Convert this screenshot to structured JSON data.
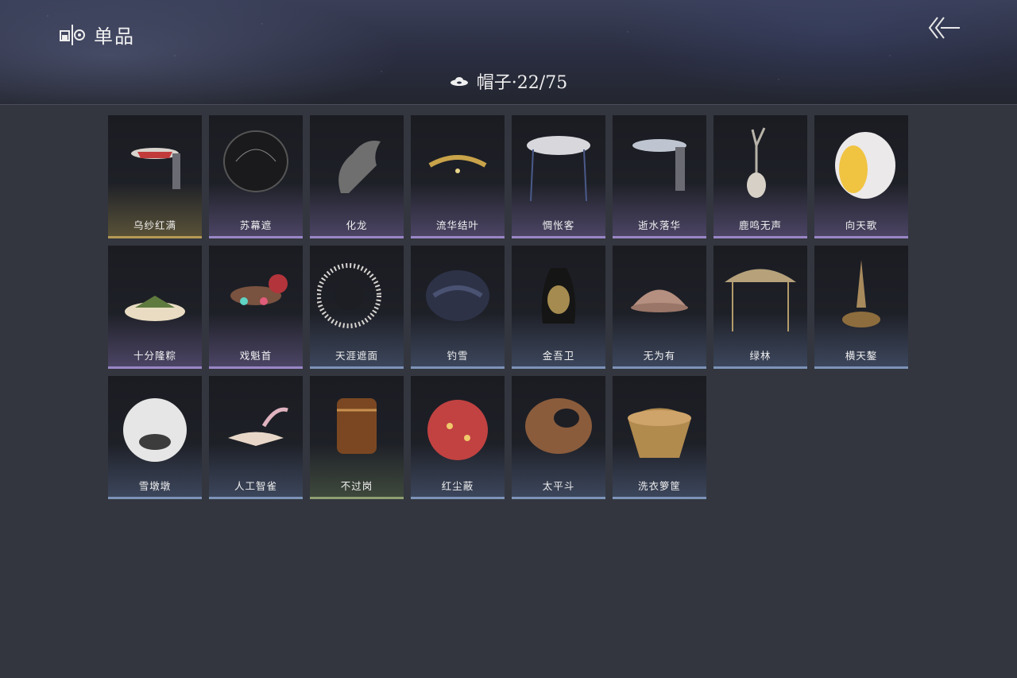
{
  "header": {
    "title": "单品",
    "category_label": "帽子·22/75",
    "icons": {
      "title": "wardrobe-icon",
      "category": "hat-icon",
      "back": "back-arrow-icon"
    }
  },
  "items": [
    {
      "name": "乌纱红满",
      "rarity": "gold"
    },
    {
      "name": "苏幕遮",
      "rarity": "purple"
    },
    {
      "name": "化龙",
      "rarity": "purple"
    },
    {
      "name": "流华结叶",
      "rarity": "purple"
    },
    {
      "name": "惆怅客",
      "rarity": "purple"
    },
    {
      "name": "逝水落华",
      "rarity": "purple"
    },
    {
      "name": "鹿鸣无声",
      "rarity": "purple"
    },
    {
      "name": "向天歌",
      "rarity": "purple"
    },
    {
      "name": "十分隆粽",
      "rarity": "purple"
    },
    {
      "name": "戏魁首",
      "rarity": "purple"
    },
    {
      "name": "天涯遮面",
      "rarity": "blue"
    },
    {
      "name": "钓雪",
      "rarity": "blue"
    },
    {
      "name": "金吾卫",
      "rarity": "blue"
    },
    {
      "name": "无为有",
      "rarity": "blue"
    },
    {
      "name": "绿林",
      "rarity": "blue"
    },
    {
      "name": "横天鏊",
      "rarity": "blue"
    },
    {
      "name": "雪墩墩",
      "rarity": "blue"
    },
    {
      "name": "人工智雀",
      "rarity": "blue"
    },
    {
      "name": "不过岗",
      "rarity": "green"
    },
    {
      "name": "红尘蔽",
      "rarity": "blue"
    },
    {
      "name": "太平斗",
      "rarity": "blue"
    },
    {
      "name": "洗衣箩筐",
      "rarity": "blue"
    }
  ]
}
